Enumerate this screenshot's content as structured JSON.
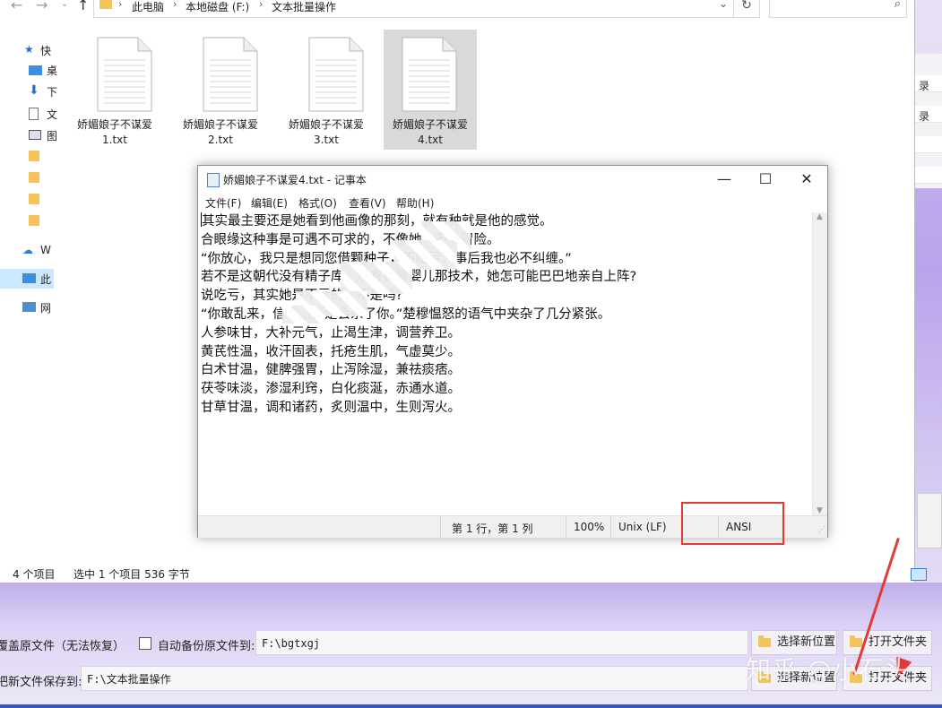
{
  "explorer": {
    "breadcrumb": [
      "此电脑",
      "本地磁盘 (F:)",
      "文本批量操作"
    ],
    "sidebar": [
      {
        "label": "快",
        "icon": "star-icon"
      },
      {
        "label": "桌",
        "icon": "desktop-icon"
      },
      {
        "label": "下",
        "icon": "download-icon"
      },
      {
        "label": "文",
        "icon": "document-icon"
      },
      {
        "label": "图",
        "icon": "picture-icon"
      },
      {
        "label": "W",
        "icon": "cloud-icon"
      },
      {
        "label": "此",
        "icon": "pc-icon"
      },
      {
        "label": "网",
        "icon": "network-icon"
      }
    ],
    "files": [
      {
        "name1": "娇媚娘子不谋爱",
        "name2": "1.txt"
      },
      {
        "name1": "娇媚娘子不谋爱",
        "name2": "2.txt"
      },
      {
        "name1": "娇媚娘子不谋爱",
        "name2": "3.txt"
      },
      {
        "name1": "娇媚娘子不谋爱",
        "name2": "4.txt"
      }
    ],
    "status": {
      "count": "4 个项目",
      "selected": "选中 1 个项目  536 字节"
    }
  },
  "notepad": {
    "title": "娇媚娘子不谋爱4.txt - 记事本",
    "menu": [
      "文件(F)",
      "编辑(E)",
      "格式(O)",
      "查看(V)",
      "帮助(H)"
    ],
    "lines": [
      "其实最主要还是她看到他画像的那刻，就有种就是他的感觉。",
      "合眼缘这种事是可遇不可求的，不像她，不会冒险。",
      "“你放心，我只是想同您借颗种子，不吃亏，事后我也必不纠缠。”",
      "若不是这朝代没有精子库，没有试管婴儿那技术，她怎可能巴巴地亲自上阵?",
      "说吃亏，其实她是不亏的，不是吗?",
      "“你敢乱来，信不信我是会杀了你。”楚穆愠怒的语气中夹杂了几分紧张。",
      "人参味甘，大补元气，止渴生津，调营养卫。",
      "黄芪性温，收汗固表，托疮生肌，气虚莫少。",
      "白术甘温，健脾强胃，止泻除湿，兼祛痰痞。",
      "茯苓味淡，渗湿利窍，白化痰涎，赤通水道。",
      "甘草甘温，调和诸药，炙则温中，生则泻火。"
    ],
    "status": {
      "position": "第 1 行，第 1 列",
      "zoom": "100%",
      "eol": "Unix (LF)",
      "encoding": "ANSI"
    }
  },
  "tool": {
    "overwrite_label": "覆盖原文件（无法恢复）",
    "backup_label": "自动备份原文件到:",
    "backup_path": "F:\\bgtxgj",
    "choose_label": "选择新位置",
    "open_label": "打开文件夹",
    "save_label": "把新文件保存到:",
    "save_path": "F:\\文本批量操作",
    "right_labels": [
      "录",
      "录"
    ]
  },
  "watermark": "知乎 @小石头"
}
